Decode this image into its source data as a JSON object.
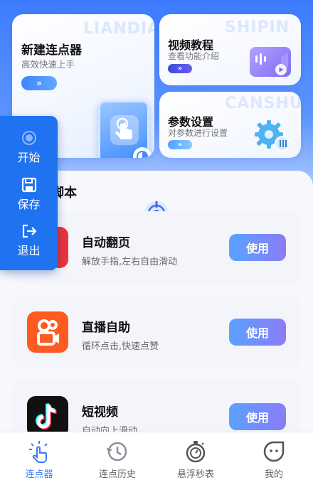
{
  "cards": {
    "new_clicker": {
      "title": "新建连点器",
      "subtitle": "高效快速上手",
      "watermark": "LIANDIAN",
      "button_glyph": "»"
    },
    "video_tutorial": {
      "title": "视频教程",
      "subtitle": "查看功能介绍",
      "watermark": "SHIPIN",
      "button_glyph": "»"
    },
    "settings": {
      "title": "参数设置",
      "subtitle": "对参数进行设置",
      "watermark": "CANSHU",
      "button_glyph": "»"
    }
  },
  "section": {
    "title": "连点器脚本"
  },
  "scripts": [
    {
      "name": "自动翻页",
      "desc": "解放手指,左右自由滑动",
      "button": "使用",
      "icon": "page-flip-icon"
    },
    {
      "name": "直播自助",
      "desc": "循环点击,快速点赞",
      "button": "使用",
      "icon": "kuaishou-icon"
    },
    {
      "name": "短视频",
      "desc": "自动向上滑动",
      "button": "使用",
      "icon": "tiktok-icon"
    }
  ],
  "float_panel": {
    "start": "开始",
    "save": "保存",
    "exit": "退出"
  },
  "nav": {
    "items": [
      {
        "label": "连点器",
        "icon": "tap-hand-icon",
        "active": true
      },
      {
        "label": "连点历史",
        "icon": "history-icon",
        "active": false
      },
      {
        "label": "悬浮秒表",
        "icon": "stopwatch-icon",
        "active": false
      },
      {
        "label": "我的",
        "icon": "profile-face-icon",
        "active": false
      }
    ]
  },
  "colors": {
    "primary": "#3b7cf5",
    "float_panel": "#1f72f0",
    "use_button_start": "#5aa2ff",
    "use_button_end": "#8a7cf7",
    "kuaishou_orange": "#ff5a1f",
    "tiktok_bg": "#111111"
  }
}
